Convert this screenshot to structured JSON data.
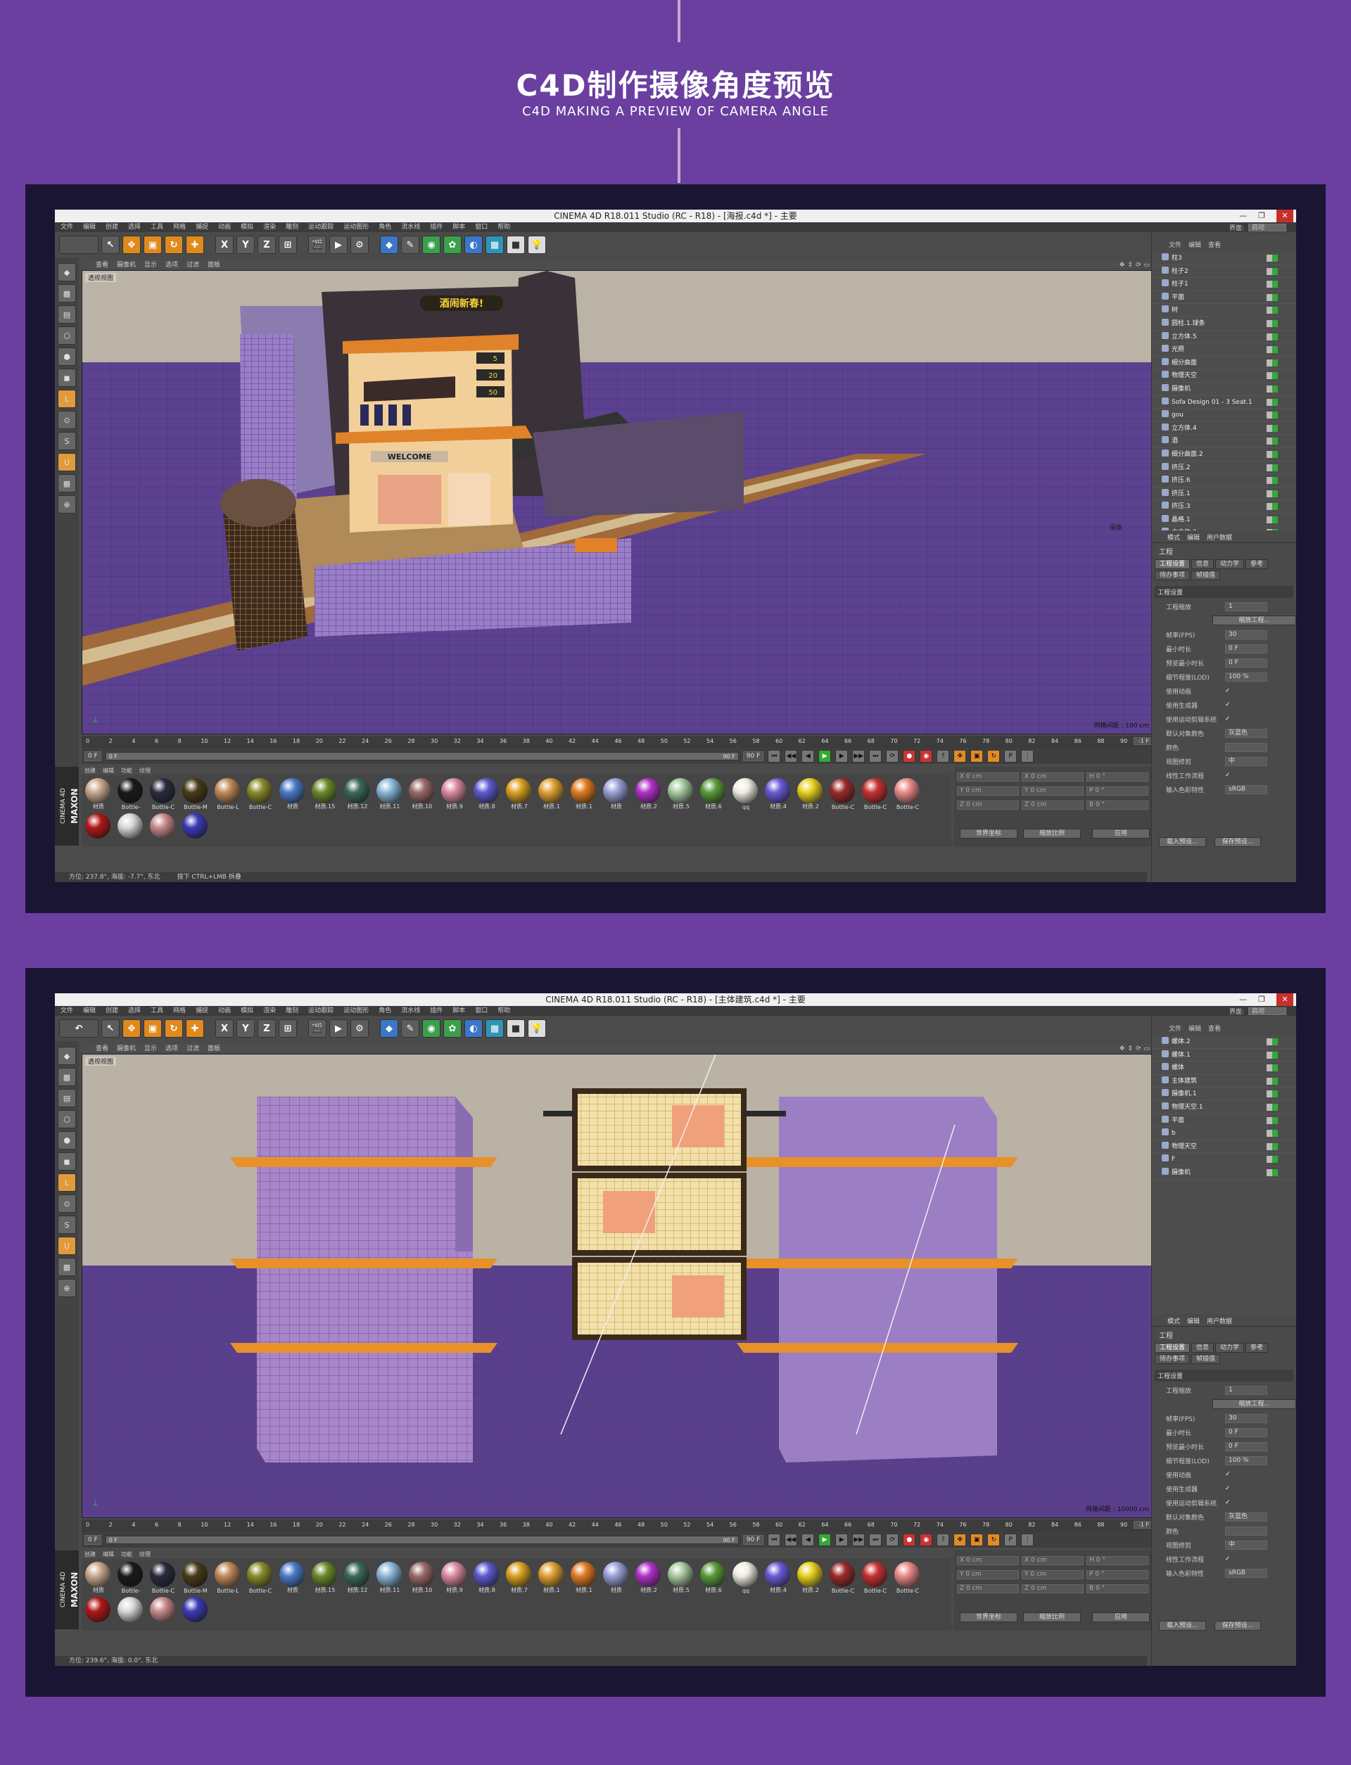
{
  "header": {
    "title": "C4D制作摄像角度预览",
    "subtitle": "C4D MAKING A PREVIEW OF CAMERA ANGLE"
  },
  "colors": {
    "page_bg": "#6a3fa0",
    "accent_orange": "#e28b25",
    "sky": "#bab2a4",
    "ground": "#5a3d8a"
  },
  "common": {
    "menu": [
      "文件",
      "编辑",
      "创建",
      "选择",
      "工具",
      "网格",
      "捕捉",
      "动画",
      "模拟",
      "渲染",
      "雕刻",
      "运动跟踪",
      "运动图形",
      "角色",
      "流水线",
      "插件",
      "脚本",
      "窗口",
      "帮助"
    ],
    "interface_label": "界面:",
    "interface_value": "启动",
    "toolbar_letters": [
      "X",
      "Y",
      "Z"
    ],
    "viewport_menu": [
      "查看",
      "摄像机",
      "显示",
      "选项",
      "过滤",
      "面板"
    ],
    "viewport_label": "透视视图",
    "timeline_ticks": [
      "0",
      "2",
      "4",
      "6",
      "8",
      "10",
      "12",
      "14",
      "16",
      "18",
      "20",
      "22",
      "24",
      "26",
      "28",
      "30",
      "32",
      "34",
      "36",
      "38",
      "40",
      "42",
      "44",
      "46",
      "48",
      "50",
      "52",
      "54",
      "56",
      "58",
      "60",
      "62",
      "64",
      "66",
      "68",
      "70",
      "72",
      "74",
      "76",
      "78",
      "80",
      "82",
      "84",
      "86",
      "88",
      "90"
    ],
    "timeline_end": "-1 F",
    "play_start": "0 F",
    "play_slider_start": "0 F",
    "play_slider_end": "90 F",
    "play_end": "90 F",
    "mat_menu": [
      "创建",
      "编辑",
      "功能",
      "纹理"
    ],
    "maxon": "MAXON",
    "maxon_sub": "CINEMA 4D",
    "materials": [
      {
        "label": "材质",
        "color": "#c9a890"
      },
      {
        "label": "Bottle-",
        "color": "#1a1a1a"
      },
      {
        "label": "Bottle-C",
        "color": "#2a2a40"
      },
      {
        "label": "Bottle-M",
        "color": "#4a3a18"
      },
      {
        "label": "Bottle-L",
        "color": "#c28a5a"
      },
      {
        "label": "Bottle-C",
        "color": "#8a8a2a"
      },
      {
        "label": "材质",
        "color": "#4a7ac8"
      },
      {
        "label": "材质.15",
        "color": "#6a8a2a"
      },
      {
        "label": "材质.12",
        "color": "#3a6a5a"
      },
      {
        "label": "材质.11",
        "color": "#8ab8d8"
      },
      {
        "label": "材质.10",
        "color": "#9a6a6a"
      },
      {
        "label": "材质.9",
        "color": "#d88aa0"
      },
      {
        "label": "材质.8",
        "color": "#5a5ad0"
      },
      {
        "label": "材质.7",
        "color": "#d8a020"
      },
      {
        "label": "材质.1",
        "color": "#e0a030"
      },
      {
        "label": "材质.1",
        "color": "#e07a20"
      },
      {
        "label": "材质",
        "color": "#9aa0d8"
      },
      {
        "label": "材质.2",
        "color": "#b030c8"
      },
      {
        "label": "材质.5",
        "color": "#a8c8a0"
      },
      {
        "label": "材质.6",
        "color": "#5a9a3a"
      },
      {
        "label": "qq",
        "color": "#f0ece0"
      },
      {
        "label": "材质.4",
        "color": "#6a5ad8"
      },
      {
        "label": "材质.2",
        "color": "#e8d020"
      },
      {
        "label": "Bottle-C",
        "color": "#9a2a2a"
      },
      {
        "label": "Bottle-C",
        "color": "#c83030"
      },
      {
        "label": "Bottle-C",
        "color": "#e88a8a"
      },
      {
        "label": "",
        "color": "#b01818"
      },
      {
        "label": "",
        "color": "#d8d8d8"
      },
      {
        "label": "",
        "color": "#c88a8a"
      },
      {
        "label": "",
        "color": "#3a3ab8"
      }
    ],
    "coords": {
      "rows": [
        [
          "X",
          "0 cm",
          "X",
          "0 cm",
          "H",
          "0 °"
        ],
        [
          "Y",
          "0 cm",
          "Y",
          "0 cm",
          "P",
          "0 °"
        ],
        [
          "Z",
          "0 cm",
          "Z",
          "0 cm",
          "B",
          "0 °"
        ]
      ],
      "btn_world": "世界坐标",
      "btn_scale": "缩放比例",
      "btn_apply": "应用"
    },
    "obj_menu": [
      "文件",
      "编辑",
      "查看"
    ],
    "attr_menu": [
      "模式",
      "编辑",
      "用户数据"
    ],
    "attr_title": "工程",
    "attr_tabs": [
      "工程设置",
      "信息",
      "动力学",
      "参考",
      "待办事项",
      "帧插值"
    ],
    "attr_section": "工程设置",
    "props": [
      {
        "label": "工程缩放",
        "value": "1"
      },
      {
        "label": "",
        "button": "缩放工程..."
      },
      {
        "label": "帧率(FPS)",
        "value": "30"
      },
      {
        "label": "最小时长",
        "value": "0 F"
      },
      {
        "label": "预览最小时长",
        "value": "0 F"
      },
      {
        "label": "细节程度(LOD)",
        "value": "100 %"
      },
      {
        "label": "使用动画",
        "check": "✓"
      },
      {
        "label": "使用生成器",
        "check": "✓"
      },
      {
        "label": "使用运动剪辑系统",
        "check": "✓"
      },
      {
        "label": "默认对象颜色",
        "value": "灰蓝色"
      },
      {
        "label": "颜色",
        "value": ""
      },
      {
        "label": "视图修剪",
        "value": "中"
      },
      {
        "label": "线性工作流程",
        "check": "✓"
      },
      {
        "label": "输入色彩特性",
        "value": "sRGB"
      }
    ],
    "attr_btn_load": "载入预设...",
    "attr_btn_save": "保存预设..."
  },
  "screens": [
    {
      "title": "CINEMA 4D R18.011 Studio (RC - R18) - [海报.c4d *] - 主要",
      "objects": [
        "柱3",
        "柱子2",
        "柱子1",
        "平面",
        "树",
        "圆柱.1.球条",
        "立方体.5",
        "光照",
        "细分曲面",
        "物理天空",
        "摄像机",
        "Sofa Design 01 - 3 Seat.1",
        "gou",
        "立方体.4",
        "酒",
        "细分曲面.2",
        "挤压.2",
        "挤压.6",
        "挤压.1",
        "挤压.3",
        "晶格.1",
        "立方体.3"
      ],
      "grid_label": "网格间距 : 100 cm",
      "cam_label": "摄像",
      "status_angle": "方位: 237.8°, 海拔: -7.7°, 东北",
      "status_hint": "按下 CTRL+LMB 拆叠",
      "sign_text": "酒闹新春!",
      "welcome": "WELCOME",
      "prices": [
        "5",
        "20",
        "50"
      ]
    },
    {
      "title": "CINEMA 4D R18.011 Studio (RC - R18) - [主体建筑.c4d *] - 主要",
      "objects": [
        "螺体.2",
        "螺体.1",
        "螺体",
        "主体建筑",
        "摄像机.1",
        "物理天空.1",
        "平面",
        "b",
        "物理天空",
        "F",
        "摄像机"
      ],
      "grid_label": "网格间距 : 10000 cm",
      "cam_label": "",
      "status_angle": "方位: 239.6°, 海拔: 0.0°, 东北",
      "status_hint": ""
    }
  ]
}
